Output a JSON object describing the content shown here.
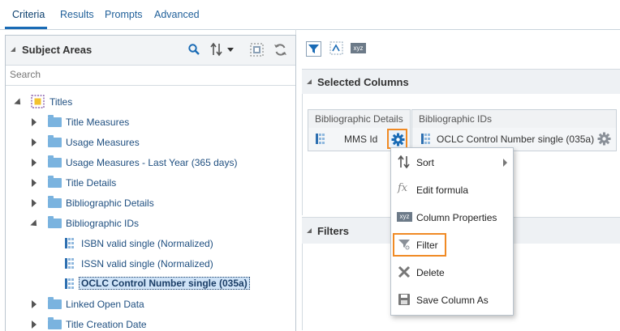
{
  "tabs": {
    "criteria": "Criteria",
    "results": "Results",
    "prompts": "Prompts",
    "advanced": "Advanced"
  },
  "subject_areas": {
    "title": "Subject Areas",
    "search_placeholder": "Search",
    "root": "Titles",
    "items": [
      {
        "label": "Title Measures",
        "type": "folder",
        "expanded": false
      },
      {
        "label": "Usage Measures",
        "type": "folder",
        "expanded": false
      },
      {
        "label": "Usage Measures - Last Year (365 days)",
        "type": "folder",
        "expanded": false
      },
      {
        "label": "Title Details",
        "type": "folder",
        "expanded": false
      },
      {
        "label": "Bibliographic Details",
        "type": "folder",
        "expanded": false
      },
      {
        "label": "Bibliographic IDs",
        "type": "folder",
        "expanded": true
      },
      {
        "label": "ISBN valid single (Normalized)",
        "type": "column"
      },
      {
        "label": "ISSN valid single (Normalized)",
        "type": "column"
      },
      {
        "label": "OCLC Control Number single (035a)",
        "type": "column",
        "selected": true
      },
      {
        "label": "Linked Open Data",
        "type": "folder",
        "expanded": false
      },
      {
        "label": "Title Creation Date",
        "type": "folder",
        "expanded": false
      }
    ]
  },
  "selected_columns": {
    "title": "Selected Columns",
    "columns": [
      {
        "header": "Bibliographic Details",
        "value": "MMS Id"
      },
      {
        "header": "Bibliographic IDs",
        "value": "OCLC Control Number single (035a)"
      }
    ]
  },
  "filters": {
    "title": "Filters"
  },
  "toolbar": {
    "xyz_label": "xyz"
  },
  "context_menu": {
    "items": [
      {
        "label": "Sort",
        "icon": "sort-icon",
        "submenu": true
      },
      {
        "label": "Edit formula",
        "icon": "formula-icon"
      },
      {
        "label": "Column Properties",
        "icon": "xyz-icon"
      },
      {
        "label": "Filter",
        "icon": "filter-icon",
        "highlighted": true
      },
      {
        "label": "Delete",
        "icon": "delete-icon"
      },
      {
        "label": "Save Column As",
        "icon": "save-icon"
      }
    ],
    "formula_glyph": "fx",
    "xyz_glyph": "xyz"
  },
  "colors": {
    "accent": "#1a6bb5",
    "highlight": "#f08a24",
    "folder": "#7ab3df",
    "selection": "#cfe3f7"
  }
}
